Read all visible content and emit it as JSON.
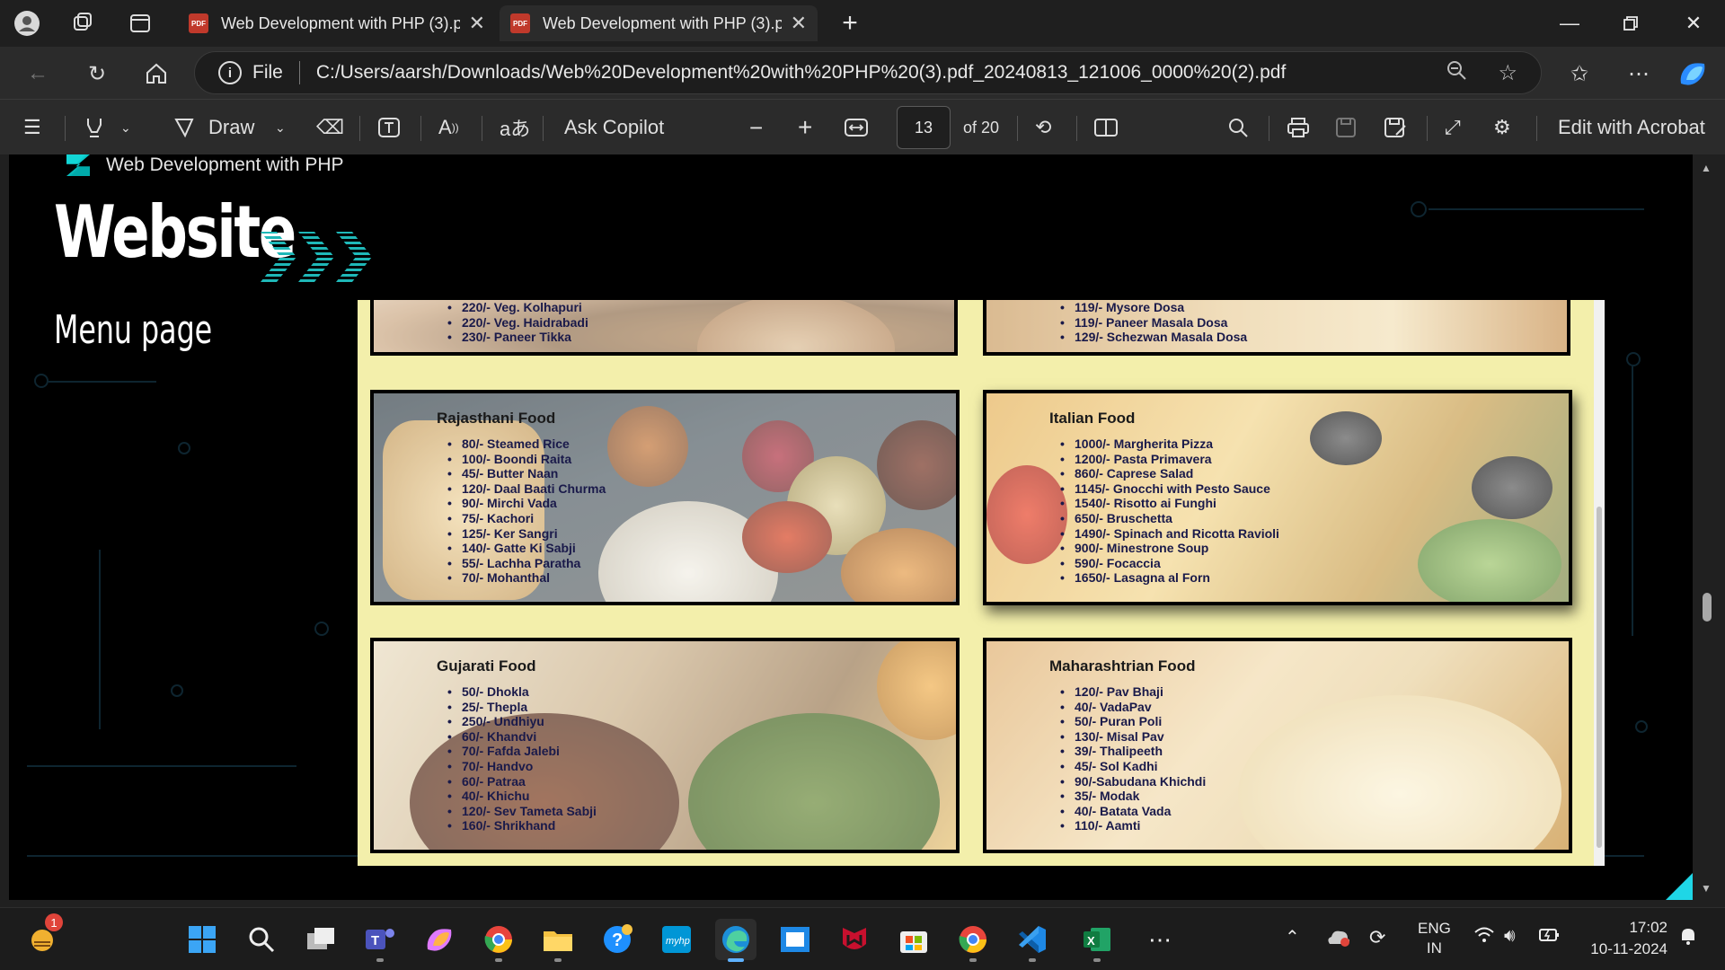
{
  "browser": {
    "tabs": [
      {
        "title": "Web Development with PHP (3).p",
        "active": false
      },
      {
        "title": "Web Development with PHP (3).p",
        "active": true
      }
    ],
    "address": {
      "scheme_label": "File",
      "url": "C:/Users/aarsh/Downloads/Web%20Development%20with%20PHP%20(3).pdf_20240813_121006_0000%20(2).pdf"
    }
  },
  "pdf_toolbar": {
    "draw_label": "Draw",
    "ask_copilot_label": "Ask Copilot",
    "page_current": "13",
    "page_total_label": "of 20",
    "edit_acrobat_label": "Edit with Acrobat"
  },
  "slide": {
    "brand": "Web Development with PHP",
    "title": "Website",
    "subtitle": "Menu page"
  },
  "menu": {
    "top_left_items": [
      "220/- Veg. Kolhapuri",
      "220/- Veg. Haidrabadi",
      "230/- Paneer Tikka"
    ],
    "top_right_items": [
      "119/- Mysore Dosa",
      "119/- Paneer Masala Dosa",
      "129/- Schezwan Masala Dosa"
    ],
    "cards": [
      {
        "title": "Rajasthani Food",
        "items": [
          "80/- Steamed Rice",
          "100/- Boondi Raita",
          "45/- Butter Naan",
          "120/- Daal Baati Churma",
          "90/- Mirchi Vada",
          "75/- Kachori",
          "125/- Ker Sangri",
          "140/- Gatte Ki Sabji",
          "55/- Lachha Paratha",
          "70/- Mohanthal"
        ]
      },
      {
        "title": "Italian Food",
        "items": [
          "1000/- Margherita Pizza",
          "1200/- Pasta Primavera",
          "860/- Caprese Salad",
          "1145/- Gnocchi with Pesto Sauce",
          "1540/- Risotto ai Funghi",
          "650/- Bruschetta",
          "1490/- Spinach and Ricotta Ravioli",
          "900/- Minestrone Soup",
          "590/- Focaccia",
          "1650/- Lasagna al Forn"
        ]
      },
      {
        "title": "Gujarati Food",
        "items": [
          "50/- Dhokla",
          "25/- Thepla",
          "250/- Undhiyu",
          "60/- Khandvi",
          "70/- Fafda Jalebi",
          "70/- Handvo",
          "60/- Patraa",
          "40/- Khichu",
          "120/- Sev Tameta Sabji",
          "160/- Shrikhand"
        ]
      },
      {
        "title": "Maharashtrian Food",
        "items": [
          "120/- Pav Bhaji",
          "40/- VadaPav",
          "50/- Puran Poli",
          "130/- Misal Pav",
          "39/- Thalipeeth",
          "45/- Sol Kadhi",
          "90/-Sabudana Khichdi",
          "35/- Modak",
          "40/- Batata Vada",
          "110/- Aamti"
        ]
      }
    ]
  },
  "taskbar": {
    "notification_count": "1",
    "lang_top": "ENG",
    "lang_bottom": "IN",
    "time": "17:02",
    "date": "10-11-2024",
    "apps": [
      "start-icon",
      "search-icon",
      "task-view-icon",
      "teams-icon",
      "copilot-icon",
      "chrome-icon",
      "file-explorer-icon",
      "help-icon",
      "myhp-icon",
      "edge-icon",
      "app-icon",
      "mcafee-icon",
      "store-icon",
      "chrome-icon",
      "vscode-icon",
      "excel-icon"
    ]
  },
  "colors": {
    "accent_cyan": "#1fb8b8",
    "menu_background": "#f3efab",
    "edge_active": "#5fb2ff"
  }
}
